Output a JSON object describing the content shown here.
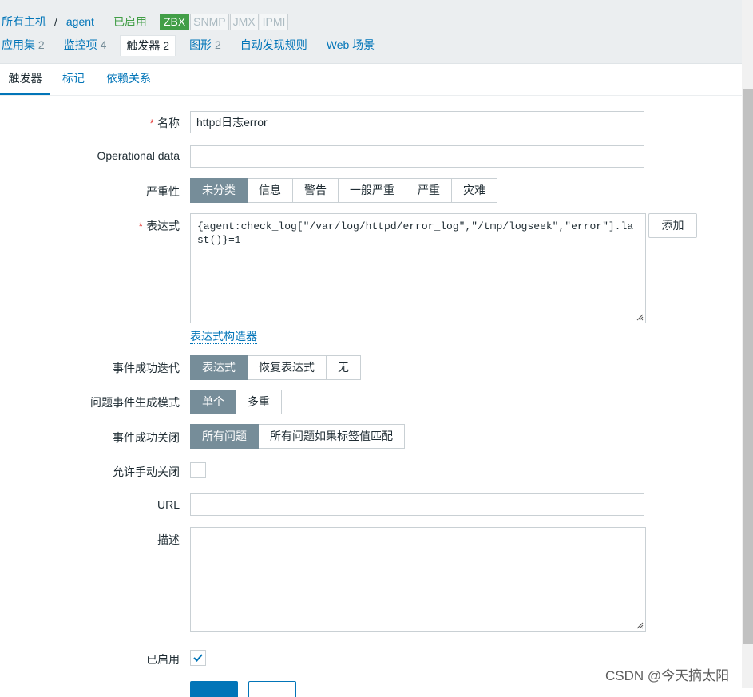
{
  "breadcrumb": {
    "all_hosts": "所有主机",
    "separator": "/",
    "host": "agent",
    "status": "已启用",
    "interfaces": [
      "ZBX",
      "SNMP",
      "JMX",
      "IPMI"
    ]
  },
  "host_tabs": [
    {
      "label": "应用集",
      "count": "2"
    },
    {
      "label": "监控项",
      "count": "4"
    },
    {
      "label": "触发器",
      "count": "2"
    },
    {
      "label": "图形",
      "count": "2"
    },
    {
      "label": "自动发现规则",
      "count": ""
    },
    {
      "label": "Web 场景",
      "count": ""
    }
  ],
  "sub_tabs": [
    "触发器",
    "标记",
    "依赖关系"
  ],
  "form": {
    "name_label": "名称",
    "name_value": "httpd日志error",
    "opdata_label": "Operational data",
    "opdata_value": "",
    "severity_label": "严重性",
    "severity_options": [
      "未分类",
      "信息",
      "警告",
      "一般严重",
      "严重",
      "灾难"
    ],
    "expression_label": "表达式",
    "expression_value": "{agent:check_log[\"/var/log/httpd/error_log\",\"/tmp/logseek\",\"error\"].last()}=1",
    "add_button": "添加",
    "expression_builder": "表达式构造器",
    "ok_event_label": "事件成功迭代",
    "ok_event_options": [
      "表达式",
      "恢复表达式",
      "无"
    ],
    "problem_mode_label": "问题事件生成模式",
    "problem_mode_options": [
      "单个",
      "多重"
    ],
    "ok_close_label": "事件成功关闭",
    "ok_close_options": [
      "所有问题",
      "所有问题如果标签值匹配"
    ],
    "manual_close_label": "允许手动关闭",
    "manual_close_checked": false,
    "url_label": "URL",
    "url_value": "",
    "description_label": "描述",
    "description_value": "",
    "enabled_label": "已启用",
    "enabled_checked": true
  },
  "watermark": "CSDN @今天摘太阳",
  "colors": {
    "accent": "#0275b8",
    "selected": "#768d99",
    "enabled_green": "#429e47",
    "required": "#e33734"
  }
}
